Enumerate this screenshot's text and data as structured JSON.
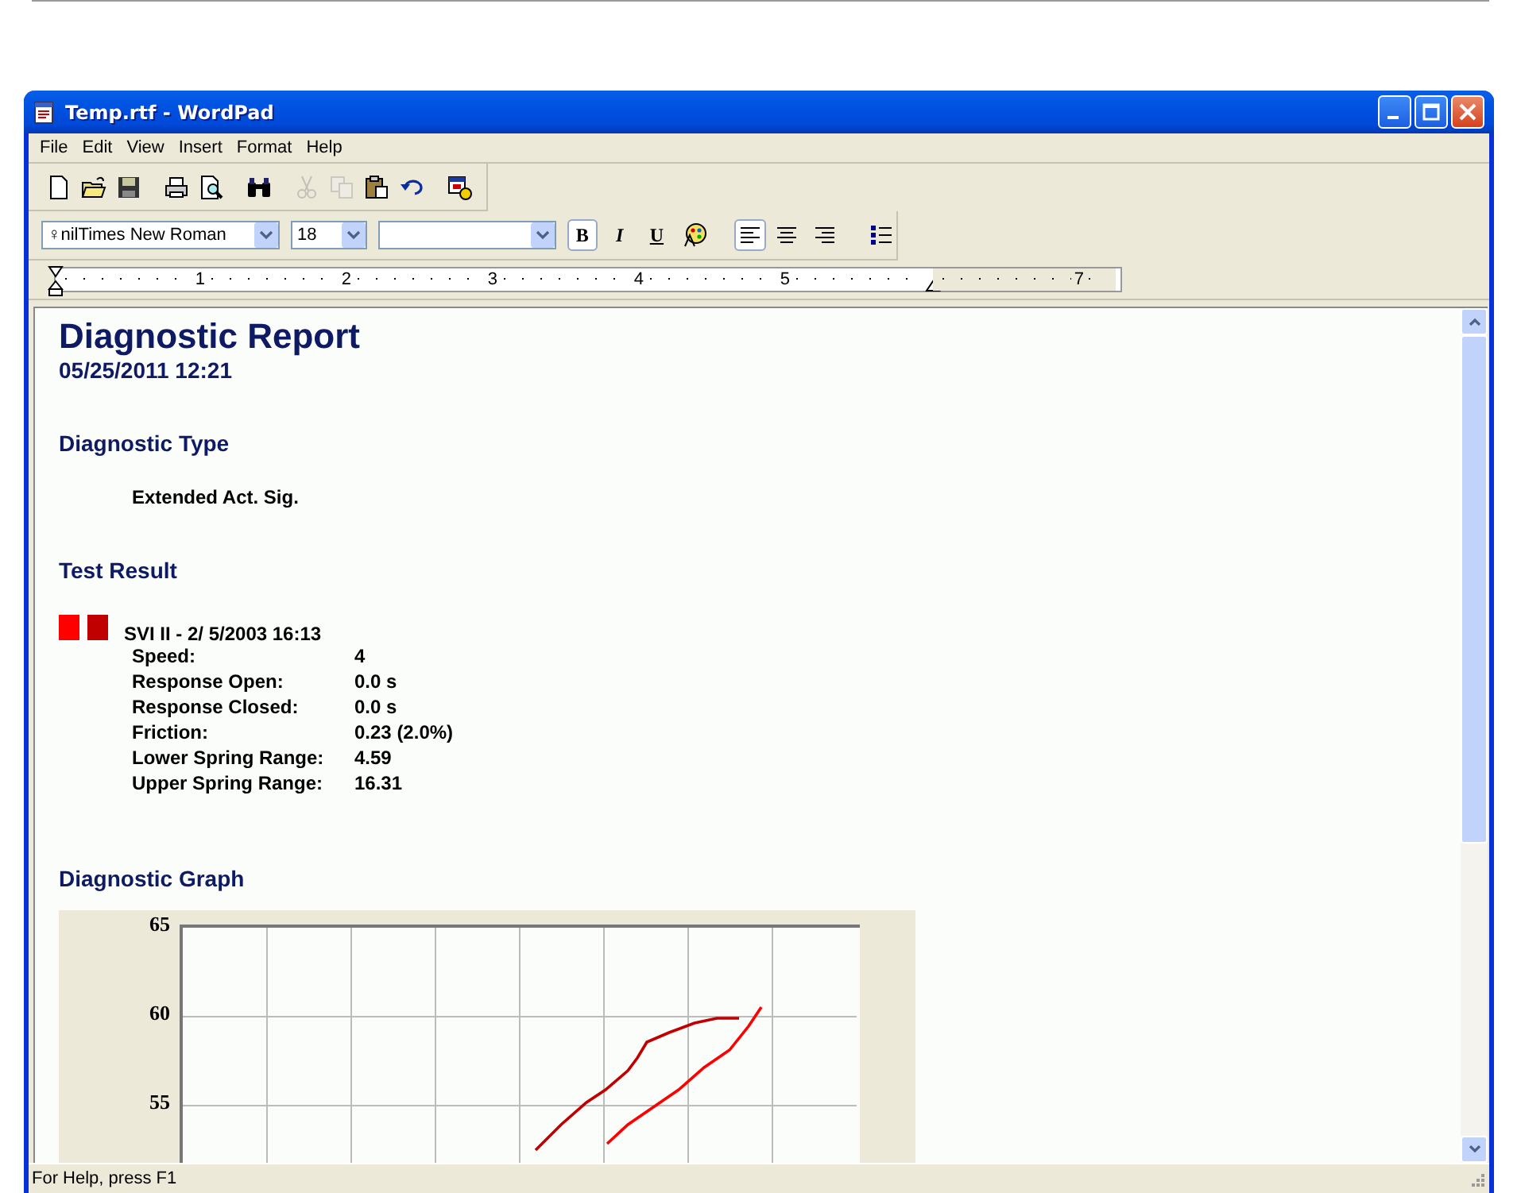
{
  "window": {
    "title": "Temp.rtf - WordPad"
  },
  "menu": [
    "File",
    "Edit",
    "View",
    "Insert",
    "Format",
    "Help"
  ],
  "toolbar": [
    {
      "kind": "new",
      "disabled": false
    },
    {
      "kind": "open",
      "disabled": false
    },
    {
      "kind": "save",
      "disabled": false
    },
    {
      "kind": "print",
      "disabled": false
    },
    {
      "kind": "preview",
      "disabled": false
    },
    {
      "kind": "find",
      "disabled": false
    },
    {
      "kind": "cut",
      "disabled": true
    },
    {
      "kind": "copy",
      "disabled": true
    },
    {
      "kind": "paste",
      "disabled": false
    },
    {
      "kind": "undo",
      "disabled": false
    },
    {
      "kind": "date",
      "disabled": false
    }
  ],
  "format_bar": {
    "font": "♀nilTimes New Roman",
    "size": "18",
    "styles": [
      {
        "kind": "bold",
        "label": "B",
        "selected": true
      },
      {
        "kind": "italic",
        "label": "I",
        "selected": false
      },
      {
        "kind": "underline",
        "label": "U",
        "selected": false
      },
      {
        "kind": "color",
        "selected": false
      }
    ],
    "align": [
      {
        "kind": "left",
        "selected": true
      },
      {
        "kind": "center",
        "selected": false
      },
      {
        "kind": "right",
        "selected": false
      }
    ]
  },
  "ruler": {
    "labels": [
      "1",
      "2",
      "3",
      "4",
      "5",
      "7"
    ]
  },
  "document": {
    "title": "Diagnostic Report",
    "date": "05/25/2011 12:21",
    "type_heading": "Diagnostic Type",
    "type": "Extended Act. Sig.",
    "result_heading": "Test Result",
    "markers": [
      {
        "color": "#ff0000"
      },
      {
        "color": "#c00000"
      }
    ],
    "device": "SVI II -  2/ 5/2003 16:13",
    "results": [
      {
        "label": "Speed:",
        "value": "4"
      },
      {
        "label": "Response Open:",
        "value": "0.0 s"
      },
      {
        "label": "Response Closed:",
        "value": "0.0 s"
      },
      {
        "label": "Friction:",
        "value": "0.23  (2.0%)"
      },
      {
        "label": "Lower Spring Range:",
        "value": "4.59"
      },
      {
        "label": "Upper Spring Range:",
        "value": "16.31"
      }
    ],
    "graph_heading": "Diagnostic Graph",
    "graph": {
      "y_tick_labels": [
        "65",
        "60",
        "55"
      ]
    }
  },
  "status_bar": "For Help, press F1"
}
